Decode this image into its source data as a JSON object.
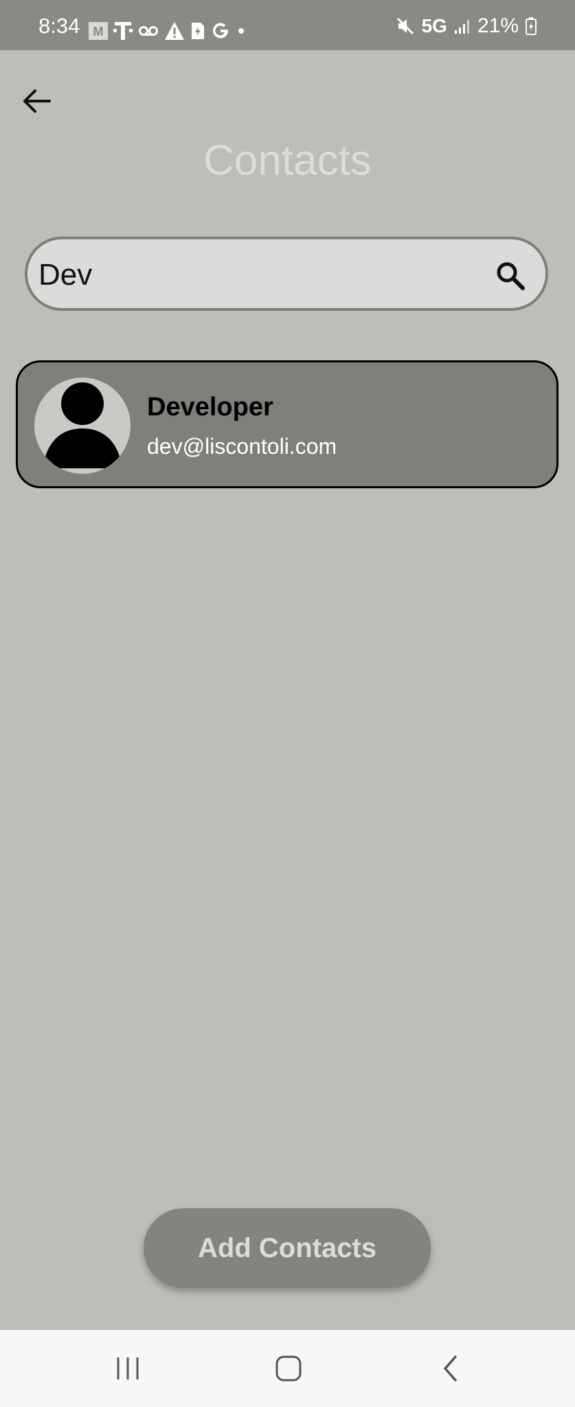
{
  "status_bar": {
    "time": "8:34",
    "network": "5G",
    "battery": "21%",
    "icons": [
      "gmail-icon",
      "tmobile-icon",
      "voicemail-icon",
      "warning-icon",
      "sim-icon",
      "google-icon",
      "dot-icon",
      "mute-icon",
      "signal-icon",
      "battery-icon"
    ]
  },
  "header": {
    "title": "Contacts",
    "back_icon": "arrow-left-icon"
  },
  "search": {
    "value": "Dev",
    "placeholder": "",
    "icon": "search-icon"
  },
  "contacts": [
    {
      "name": "Developer",
      "email": "dev@liscontoli.com",
      "avatar_icon": "person-icon"
    }
  ],
  "actions": {
    "add_label": "Add Contacts"
  },
  "nav": {
    "icons": [
      "recents-icon",
      "home-icon",
      "back-icon"
    ]
  },
  "colors": {
    "background": "#bebdb8",
    "status_bar": "#898985",
    "card": "#807f7b",
    "button": "#84837f",
    "title": "#dcdcd8"
  }
}
